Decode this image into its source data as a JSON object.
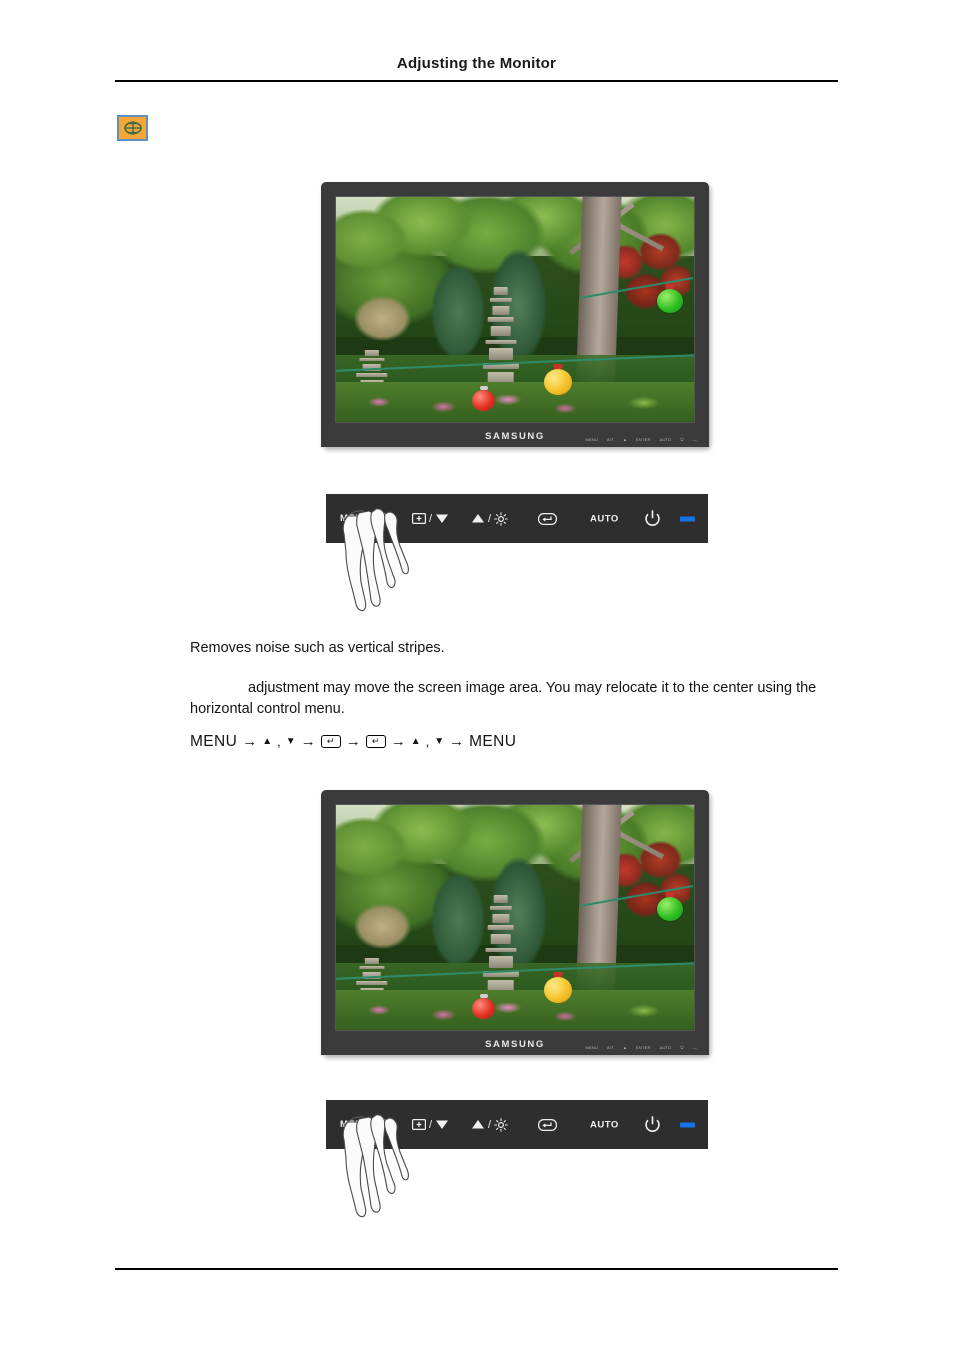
{
  "header": {
    "title": "Adjusting the Monitor"
  },
  "feature": {
    "icon_name": "coarse-adjust-icon",
    "icon_bg": "#f5a636",
    "icon_border": "#5d8ec4"
  },
  "monitor": {
    "brand": "SAMSUNG",
    "bezel_color": "#3b3b3b",
    "bezel_labels": [
      "MENU",
      "A/T",
      "▲",
      "ENTER",
      "AUTO",
      "⏻",
      "—"
    ],
    "screen_alt": "garden scene with stone pagodas, trees and paper lanterns"
  },
  "osd_panel": {
    "panel_color": "#2e2e2e",
    "led_color": "#1673e8",
    "buttons": [
      {
        "name": "menu-button",
        "label": "MENU",
        "separator": "/",
        "icon": "osd-window-icon"
      },
      {
        "name": "source-down-button",
        "label": "",
        "separator": "/",
        "icon": "source-icon",
        "icon2": "triangle-down-icon"
      },
      {
        "name": "brightness-up-button",
        "label": "",
        "separator": "/",
        "icon": "triangle-up-icon",
        "icon2": "brightness-sun-icon"
      },
      {
        "name": "enter-button",
        "label": "",
        "icon": "enter-key-icon"
      },
      {
        "name": "auto-button",
        "label": "AUTO"
      },
      {
        "name": "power-button",
        "label": "",
        "icon": "power-icon"
      },
      {
        "name": "power-led",
        "label": "",
        "icon": "led-indicator"
      }
    ]
  },
  "content": {
    "removes_noise": "Removes noise such as vertical stripes.",
    "note": "adjustment may move the screen image area. You may relocate it to the center using the horizontal control menu.",
    "nav": {
      "menu_start": "MENU",
      "arrow": "→",
      "up_triangle": "▲",
      "comma": ",",
      "down_triangle": "▼",
      "enter_key": "↵",
      "menu_end": "MENU"
    }
  }
}
